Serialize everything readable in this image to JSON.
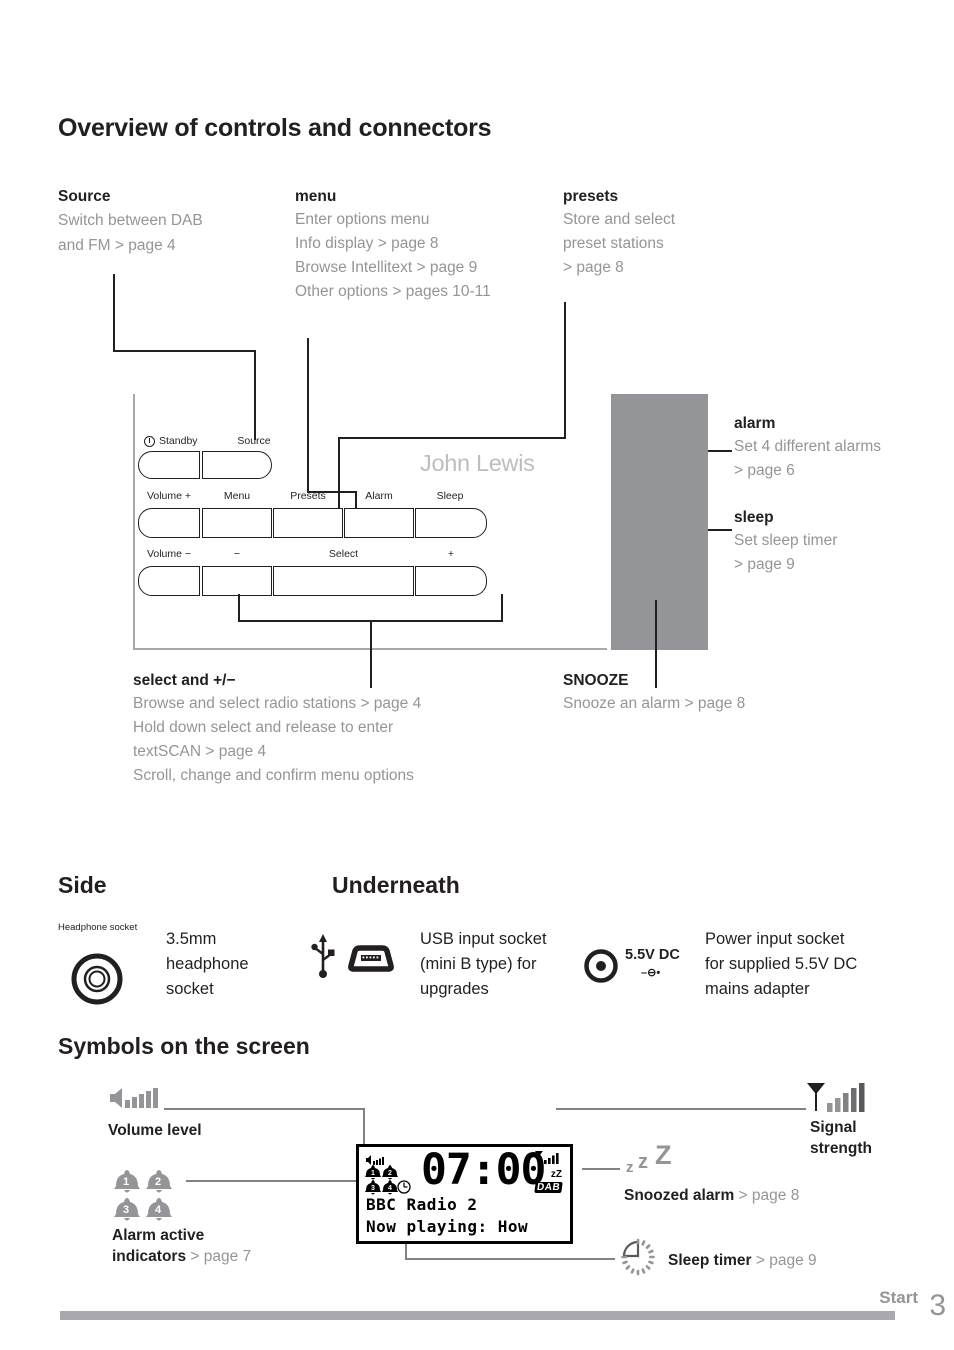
{
  "page": {
    "title": "Overview of controls and connectors",
    "footer_section": "Start",
    "footer_page_number": "3",
    "accent_gray": "#939598",
    "body_gray": "#939598",
    "ink": "#231f20"
  },
  "callouts": {
    "source": {
      "title": "Source",
      "lines": [
        "Switch between DAB",
        "and FM > page 4"
      ]
    },
    "menu": {
      "title": "menu",
      "lines": [
        "Enter options menu",
        "Info display > page 8",
        "Browse Intellitext > page 9",
        "Other options > pages 10-11"
      ]
    },
    "presets": {
      "title": "presets",
      "lines": [
        "Store and select",
        "preset stations",
        "> page 8"
      ]
    },
    "alarm": {
      "title": "alarm",
      "lines": [
        "Set 4 different alarms",
        "> page 6"
      ]
    },
    "sleep": {
      "title": "sleep",
      "lines": [
        "Set sleep timer",
        "> page 9"
      ]
    },
    "select": {
      "title_bold": "select",
      "title_rest": " and +/−",
      "lines": [
        "Browse and select radio stations > page 4",
        "Hold down select and release to enter",
        "textSCAN > page 4",
        "Scroll, change and confirm menu options"
      ]
    },
    "snooze": {
      "title": "SNOOZE",
      "lines": [
        "Snooze an alarm > page 8"
      ]
    }
  },
  "device": {
    "brand": "John Lewis",
    "standby_label": "Standby",
    "row1": [
      {
        "label": "Source"
      }
    ],
    "labels": {
      "standby": "Standby",
      "source": "Source",
      "volume_plus": "Volume +",
      "menu": "Menu",
      "presets": "Presets",
      "alarm": "Alarm",
      "sleep": "Sleep",
      "volume_minus": "Volume −",
      "minus": "−",
      "select": "Select",
      "plus": "+"
    }
  },
  "sections": {
    "side": {
      "heading": "Side"
    },
    "underneath": {
      "heading": "Underneath"
    },
    "symbols": {
      "heading": "Symbols on the screen"
    }
  },
  "connectors": {
    "headphone": {
      "icon_caption": "Headphone socket",
      "lines": [
        "3.5mm",
        "headphone",
        "socket"
      ]
    },
    "usb": {
      "lines": [
        "USB input socket",
        "(mini B type) for",
        "upgrades"
      ]
    },
    "power": {
      "voltage_label": "5.5V DC",
      "polarity": "–⊖•",
      "lines": [
        "Power input socket",
        "for supplied 5.5V DC",
        "mains adapter"
      ]
    }
  },
  "screen_symbols": {
    "volume": {
      "label": "Volume level"
    },
    "alarms": {
      "label_line1": "Alarm active",
      "label_line2": "indicators",
      "page": " > page 7",
      "numbers": [
        "1",
        "2",
        "3",
        "4"
      ]
    },
    "signal": {
      "label_line1": "Signal",
      "label_line2": "strength"
    },
    "snoozed": {
      "label": "Snoozed alarm",
      "page": " > page 8",
      "glyph": "zZZ"
    },
    "sleep_timer": {
      "label": "Sleep timer",
      "page": " > page 9"
    }
  },
  "lcd": {
    "time": "07:00",
    "line1": "BBC Radio 2",
    "line2": "Now playing: How",
    "badge_dab": "DAB",
    "snooze_glyph": "zZ"
  }
}
